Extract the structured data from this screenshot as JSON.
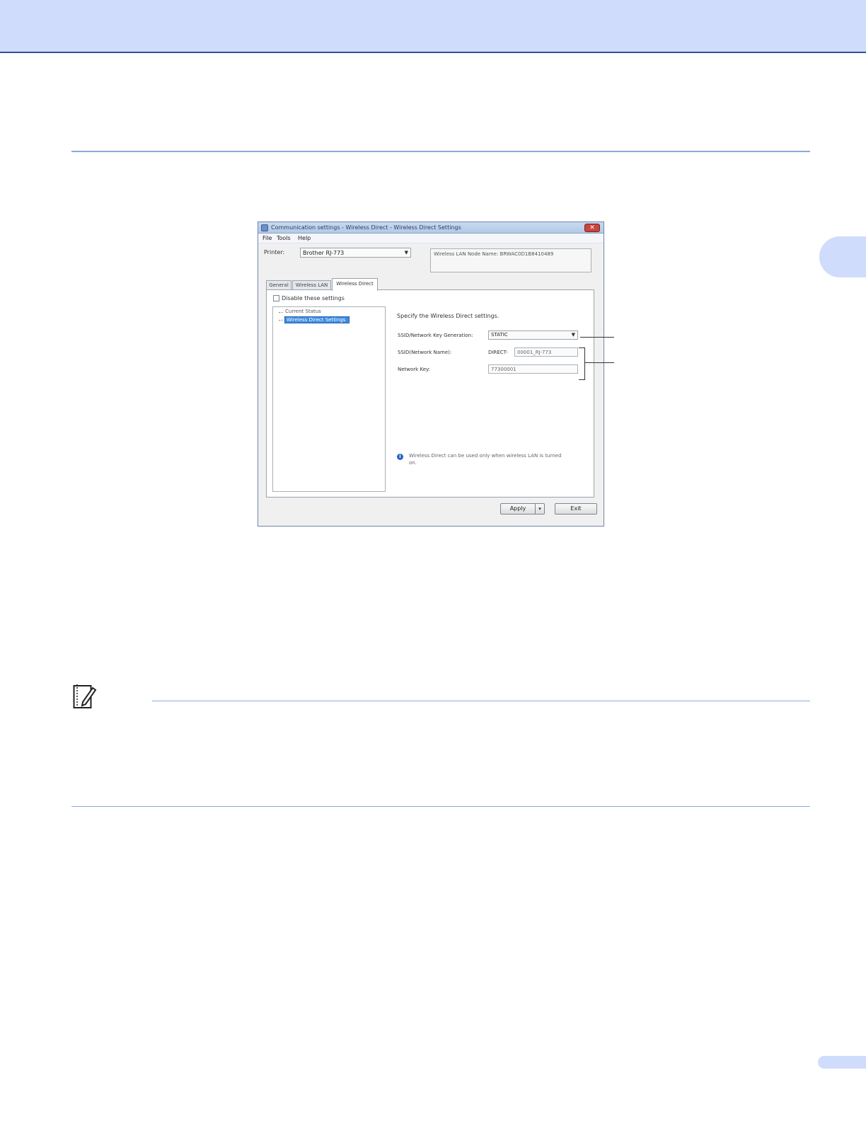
{
  "dialog": {
    "title": "Communication settings - Wireless Direct - Wireless Direct Settings",
    "close_glyph": "✕",
    "menu": [
      "File",
      "Tools",
      "Help"
    ],
    "printer_label": "Printer:",
    "printer_value": "Brother RJ-773",
    "node_name": "Wireless LAN Node Name: BRWAC0D1B8410489",
    "tabs": [
      "General",
      "Wireless LAN",
      "Wireless Direct"
    ],
    "disable_settings": "Disable these settings",
    "tree": [
      "Current Status",
      "Wireless Direct Settings"
    ],
    "heading": "Specify the Wireless Direct settings.",
    "ssid_gen_label": "SSID/Network Key Generation:",
    "ssid_gen_value": "STATIC",
    "ssid_label": "SSID(Network Name):",
    "ssid_prefix": "DIRECT-",
    "ssid_value": "00001_RJ-773",
    "key_label": "Network Key:",
    "key_value": "77300001",
    "info_glyph": "i",
    "note_line1": "Wireless Direct can be used only when wireless LAN is turned",
    "note_line2": "on.",
    "apply": "Apply",
    "split_arrow": "▾",
    "exit": "Exit"
  }
}
